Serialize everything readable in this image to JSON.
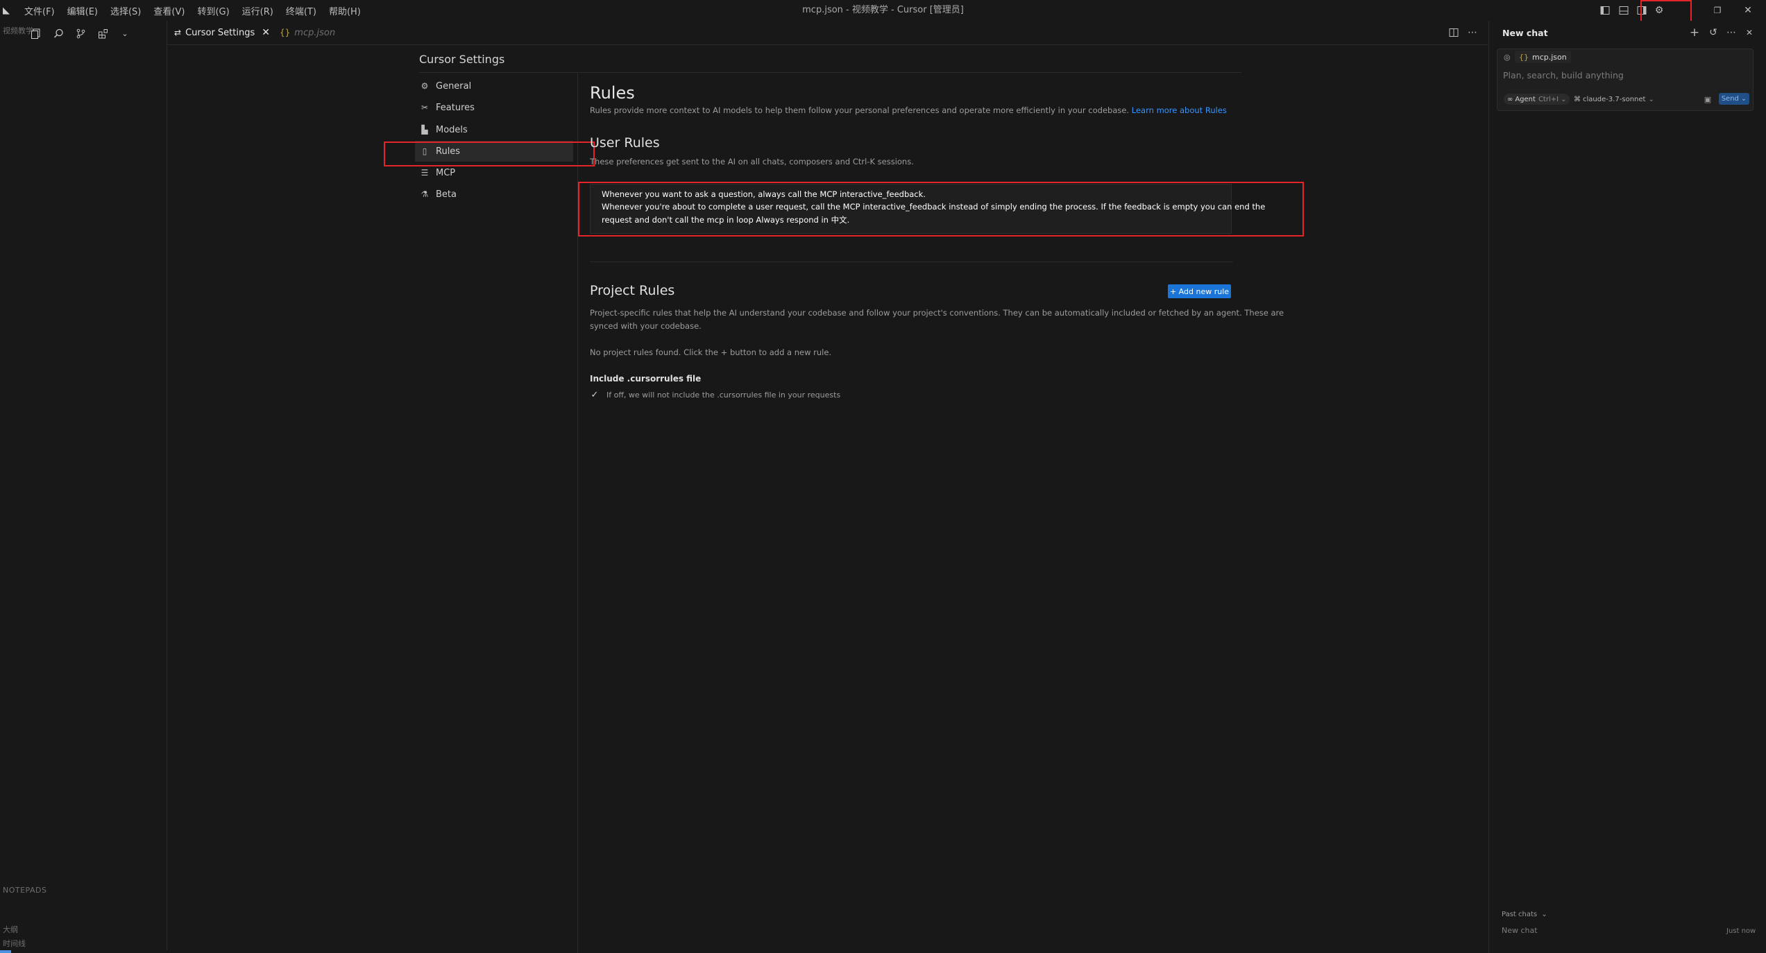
{
  "menu": {
    "items": [
      "文件(F)",
      "编辑(E)",
      "选择(S)",
      "查看(V)",
      "转到(G)",
      "运行(R)",
      "终端(T)",
      "帮助(H)"
    ]
  },
  "window": {
    "title": "mcp.json - 视频教学 - Cursor [管理员]"
  },
  "sidebar": {
    "folder_label": "视频教学",
    "notepads_label": "NOTEPADS",
    "notepads": [
      "大纲",
      "时间线"
    ]
  },
  "tabs": [
    {
      "label": "Cursor Settings",
      "icon": "settings-icon",
      "active": true
    },
    {
      "label": "mcp.json",
      "icon": "json-icon",
      "active": false
    }
  ],
  "settings": {
    "heading": "Cursor Settings",
    "nav": [
      {
        "label": "General",
        "icon": "gear-icon"
      },
      {
        "label": "Features",
        "icon": "features-icon"
      },
      {
        "label": "Models",
        "icon": "models-icon"
      },
      {
        "label": "Rules",
        "icon": "book-icon",
        "active": true
      },
      {
        "label": "MCP",
        "icon": "mcp-icon"
      },
      {
        "label": "Beta",
        "icon": "flask-icon"
      }
    ]
  },
  "rules": {
    "title": "Rules",
    "description": "Rules provide more context to AI models to help them follow your personal preferences and operate more efficiently in your codebase.",
    "learn_more": "Learn more about Rules",
    "user_rules_title": "User Rules",
    "user_rules_desc": "These preferences get sent to the AI on all chats, composers and Ctrl-K sessions.",
    "user_rules_lines": [
      "Whenever you want to ask a question, always call the MCP interactive_feedback.",
      "Whenever you're about to complete a user request, call the MCP interactive_feedback instead of simply ending the process. If the feedback is empty you can end the",
      "request and don't call the mcp in loop Always respond in 中文."
    ],
    "project_rules_title": "Project Rules",
    "add_rule_button": "+ Add new rule",
    "project_rules_desc_lines": [
      "Project-specific rules that help the AI understand your codebase and follow your project's conventions. They can be automatically included or fetched by an agent. These are",
      "synced with your codebase."
    ],
    "no_rules_text": "No project rules found. Click the + button to add a new rule.",
    "include_title": "Include .cursorrules file",
    "include_desc": "If off, we will not include the .cursorrules file in your requests",
    "include_checked": true
  },
  "chat": {
    "title": "New chat",
    "context_chip": "mcp.json",
    "placeholder": "Plan, search, build anything",
    "agent_label": "Agent",
    "agent_shortcut": "Ctrl+I",
    "model_label": "claude-3.7-sonnet",
    "send_label": "Send",
    "past_chats_label": "Past chats",
    "past_items": [
      {
        "title": "New chat",
        "time": "Just now"
      }
    ]
  },
  "colors": {
    "accent": "#1b74d8",
    "link": "#3794ff",
    "highlight_box": "#e5242a",
    "background": "#181818"
  }
}
